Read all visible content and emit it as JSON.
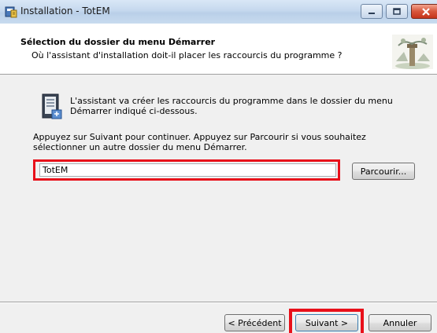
{
  "window": {
    "title": "Installation - TotEM"
  },
  "header": {
    "title": "Sélection du dossier du menu Démarrer",
    "subtitle": "Où l'assistant d'installation doit-il placer les raccourcis du programme ?"
  },
  "body": {
    "info_line1": "L'assistant va créer les raccourcis du programme dans le dossier du menu",
    "info_line2": "Démarrer indiqué ci-dessous.",
    "instruction_line1": "Appuyez sur Suivant pour continuer. Appuyez sur Parcourir si vous souhaitez",
    "instruction_line2": "sélectionner un autre dossier du menu Démarrer."
  },
  "folder_input": {
    "value": "TotEM"
  },
  "buttons": {
    "browse": "Parcourir...",
    "previous": "< Précédent",
    "next": "Suivant >",
    "cancel": "Annuler"
  },
  "colors": {
    "highlight": "#e8101a",
    "titlebar": "#c5d8ee",
    "close_button": "#d8563b"
  },
  "icons": {
    "app": "installer-icon",
    "minimize": "minimize-icon",
    "maximize": "maximize-icon",
    "close": "close-icon",
    "header_logo": "totem-logo",
    "folder": "program-folder-icon"
  }
}
